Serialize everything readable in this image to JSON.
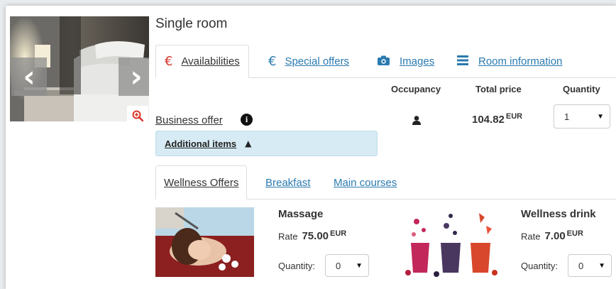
{
  "room": {
    "title": "Single room"
  },
  "tabs": [
    {
      "icon": "€",
      "label": "Availabilities",
      "active": true
    },
    {
      "icon": "€",
      "label": "Special offers",
      "active": false
    },
    {
      "icon": "camera",
      "label": "Images",
      "active": false
    },
    {
      "icon": "list",
      "label": "Room information",
      "active": false
    }
  ],
  "table": {
    "headers": {
      "occupancy": "Occupancy",
      "total_price": "Total price",
      "quantity": "Quantity"
    },
    "offer": {
      "name": "Business offer",
      "price": "104.82",
      "currency": "EUR",
      "quantity": "1"
    }
  },
  "additional_items": {
    "label": "Additional items"
  },
  "subtabs": [
    {
      "label": "Wellness Offers",
      "active": true
    },
    {
      "label": "Breakfast",
      "active": false
    },
    {
      "label": "Main courses",
      "active": false
    }
  ],
  "items": [
    {
      "name": "Massage",
      "rate_label": "Rate",
      "rate": "75.00",
      "currency": "EUR",
      "quantity_label": "Quantity:",
      "quantity": "0"
    },
    {
      "name": "Wellness drink",
      "rate_label": "Rate",
      "rate": "7.00",
      "currency": "EUR",
      "quantity_label": "Quantity:",
      "quantity": "0"
    }
  ],
  "colors": {
    "link": "#2a7ab0",
    "euro_icon_active": "#d9342b",
    "euro_icon_link": "#2a7ab0",
    "additional_bg": "#d7ebf4",
    "zoom_icon": "#d9342b"
  }
}
